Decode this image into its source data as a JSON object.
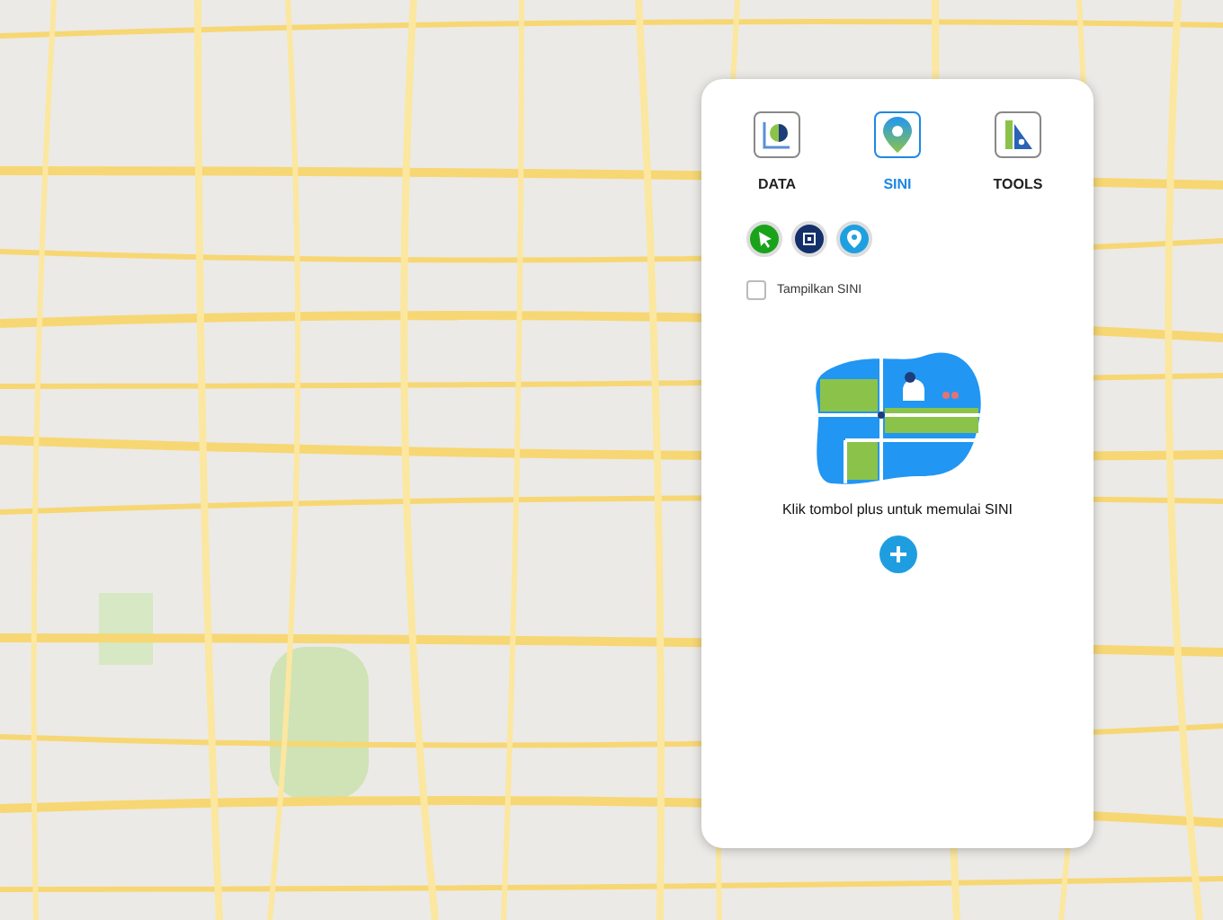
{
  "tabs": [
    {
      "label": "DATA",
      "selected": false,
      "kind": "data"
    },
    {
      "label": "SINI",
      "selected": true,
      "kind": "sini"
    },
    {
      "label": "TOOLS",
      "selected": false,
      "kind": "tools"
    }
  ],
  "quick_buttons": [
    {
      "kind": "pointer",
      "color": "#1aa31a"
    },
    {
      "kind": "chip",
      "color": "#13306b"
    },
    {
      "kind": "pin",
      "color": "#1ea0e0"
    }
  ],
  "toggle": {
    "label": "Tampilkan SINI",
    "checked": false
  },
  "empty_state": {
    "message": "Klik tombol plus untuk memulai SINI"
  }
}
